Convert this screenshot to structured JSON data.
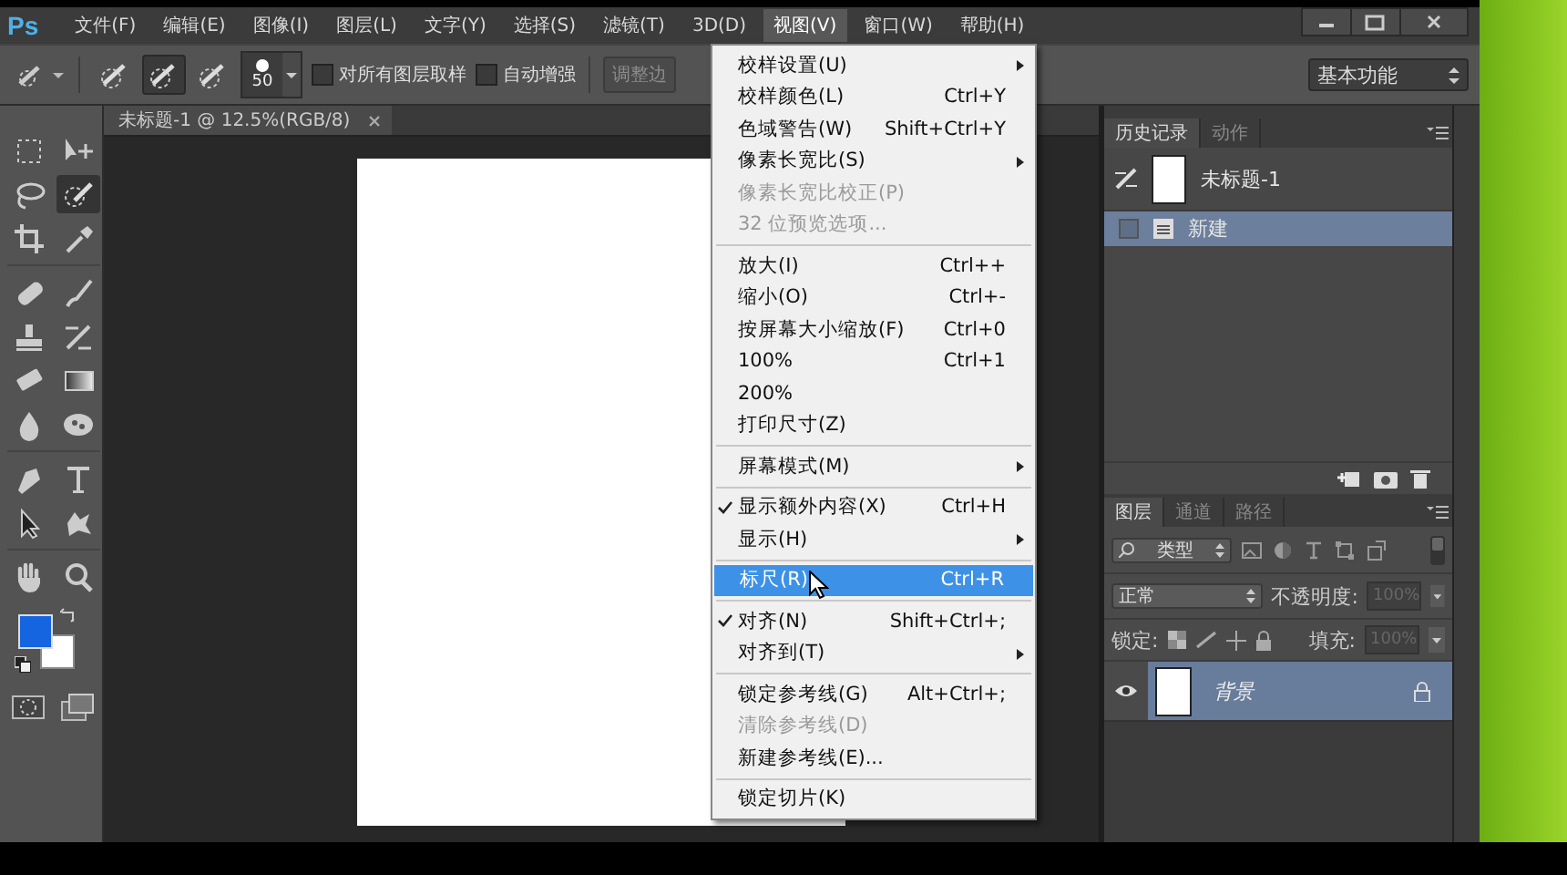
{
  "app_logo": "Ps",
  "menubar": [
    {
      "label": "文件(F)",
      "selected": false
    },
    {
      "label": "编辑(E)",
      "selected": false
    },
    {
      "label": "图像(I)",
      "selected": false
    },
    {
      "label": "图层(L)",
      "selected": false
    },
    {
      "label": "文字(Y)",
      "selected": false
    },
    {
      "label": "选择(S)",
      "selected": false
    },
    {
      "label": "滤镜(T)",
      "selected": false
    },
    {
      "label": "3D(D)",
      "selected": false
    },
    {
      "label": "视图(V)",
      "selected": true
    },
    {
      "label": "窗口(W)",
      "selected": false
    },
    {
      "label": "帮助(H)",
      "selected": false
    }
  ],
  "options_bar": {
    "brush_modes": [
      {
        "selected": false
      },
      {
        "selected": true
      },
      {
        "selected": false
      }
    ],
    "brush_size": "50",
    "checkboxes": [
      {
        "label": "对所有图层取样",
        "checked": false
      },
      {
        "label": "自动增强",
        "checked": false
      }
    ],
    "refine_button": "调整边",
    "workspace": "基本功能"
  },
  "tools": [
    {
      "kind": "marquee",
      "selected": false
    },
    {
      "kind": "move",
      "selected": false
    },
    {
      "kind": "lasso",
      "selected": false
    },
    {
      "kind": "quick-selection",
      "selected": true
    },
    {
      "kind": "crop",
      "selected": false
    },
    {
      "kind": "eyedropper",
      "selected": false
    },
    {
      "kind": "separator"
    },
    {
      "kind": "healing",
      "selected": false
    },
    {
      "kind": "brush",
      "selected": false
    },
    {
      "kind": "stamp",
      "selected": false
    },
    {
      "kind": "history-brush",
      "selected": false
    },
    {
      "kind": "eraser",
      "selected": false
    },
    {
      "kind": "gradient",
      "selected": false
    },
    {
      "kind": "blur",
      "selected": false
    },
    {
      "kind": "sponge",
      "selected": false
    },
    {
      "kind": "separator"
    },
    {
      "kind": "pen",
      "selected": false
    },
    {
      "kind": "type",
      "selected": false
    },
    {
      "kind": "path-selection",
      "selected": false
    },
    {
      "kind": "shape",
      "selected": false
    },
    {
      "kind": "separator"
    },
    {
      "kind": "hand",
      "selected": false
    },
    {
      "kind": "zoom",
      "selected": false
    }
  ],
  "document_tab": {
    "title": "未标题-1 @ 12.5%(RGB/8)",
    "selected": true
  },
  "view_menu": [
    {
      "kind": "item",
      "label": "校样设置(U)",
      "submenu": true,
      "selected": false
    },
    {
      "kind": "item",
      "label": "校样颜色(L)",
      "shortcut": "Ctrl+Y",
      "selected": false
    },
    {
      "kind": "item",
      "label": "色域警告(W)",
      "shortcut": "Shift+Ctrl+Y",
      "selected": false
    },
    {
      "kind": "item",
      "label": "像素长宽比(S)",
      "submenu": true,
      "selected": false
    },
    {
      "kind": "item",
      "label": "像素长宽比校正(P)",
      "disabled": true,
      "selected": false
    },
    {
      "kind": "item",
      "label": "32 位预览选项...",
      "disabled": true,
      "selected": false
    },
    {
      "kind": "separator"
    },
    {
      "kind": "item",
      "label": "放大(I)",
      "shortcut": "Ctrl++",
      "selected": false
    },
    {
      "kind": "item",
      "label": "缩小(O)",
      "shortcut": "Ctrl+-",
      "selected": false
    },
    {
      "kind": "item",
      "label": "按屏幕大小缩放(F)",
      "shortcut": "Ctrl+0",
      "selected": false
    },
    {
      "kind": "item",
      "label": "100%",
      "shortcut": "Ctrl+1",
      "selected": false
    },
    {
      "kind": "item",
      "label": "200%",
      "selected": false
    },
    {
      "kind": "item",
      "label": "打印尺寸(Z)",
      "selected": false
    },
    {
      "kind": "separator"
    },
    {
      "kind": "item",
      "label": "屏幕模式(M)",
      "submenu": true,
      "selected": false
    },
    {
      "kind": "separator"
    },
    {
      "kind": "item",
      "label": "显示额外内容(X)",
      "shortcut": "Ctrl+H",
      "checked": true,
      "selected": false
    },
    {
      "kind": "item",
      "label": "显示(H)",
      "submenu": true,
      "selected": false
    },
    {
      "kind": "separator"
    },
    {
      "kind": "item",
      "label": "标尺(R)",
      "shortcut": "Ctrl+R",
      "selected": true
    },
    {
      "kind": "separator"
    },
    {
      "kind": "item",
      "label": "对齐(N)",
      "shortcut": "Shift+Ctrl+;",
      "checked": true,
      "selected": false
    },
    {
      "kind": "item",
      "label": "对齐到(T)",
      "submenu": true,
      "selected": false
    },
    {
      "kind": "separator"
    },
    {
      "kind": "item",
      "label": "锁定参考线(G)",
      "shortcut": "Alt+Ctrl+;",
      "selected": false
    },
    {
      "kind": "item",
      "label": "清除参考线(D)",
      "disabled": true,
      "selected": false
    },
    {
      "kind": "item",
      "label": "新建参考线(E)...",
      "selected": false
    },
    {
      "kind": "separator"
    },
    {
      "kind": "item",
      "label": "锁定切片(K)",
      "selected": false
    }
  ],
  "history_panel": {
    "tabs": [
      {
        "label": "历史记录",
        "selected": true
      },
      {
        "label": "动作",
        "selected": false
      }
    ],
    "snapshot": "未标题-1",
    "states": [
      {
        "label": "新建",
        "selected": true
      }
    ]
  },
  "layers_panel": {
    "tabs": [
      {
        "label": "图层",
        "selected": true
      },
      {
        "label": "通道",
        "selected": false
      },
      {
        "label": "路径",
        "selected": false
      }
    ],
    "filter": "类型",
    "blend_mode": "正常",
    "opacity_label": "不透明度:",
    "opacity": {
      "value": "100%",
      "disabled": true
    },
    "lock_label": "锁定:",
    "fill_label": "填充:",
    "fill": {
      "value": "100%",
      "disabled": true
    },
    "layers": [
      {
        "name": "背景",
        "selected": true,
        "visible": true,
        "locked": true
      }
    ]
  }
}
